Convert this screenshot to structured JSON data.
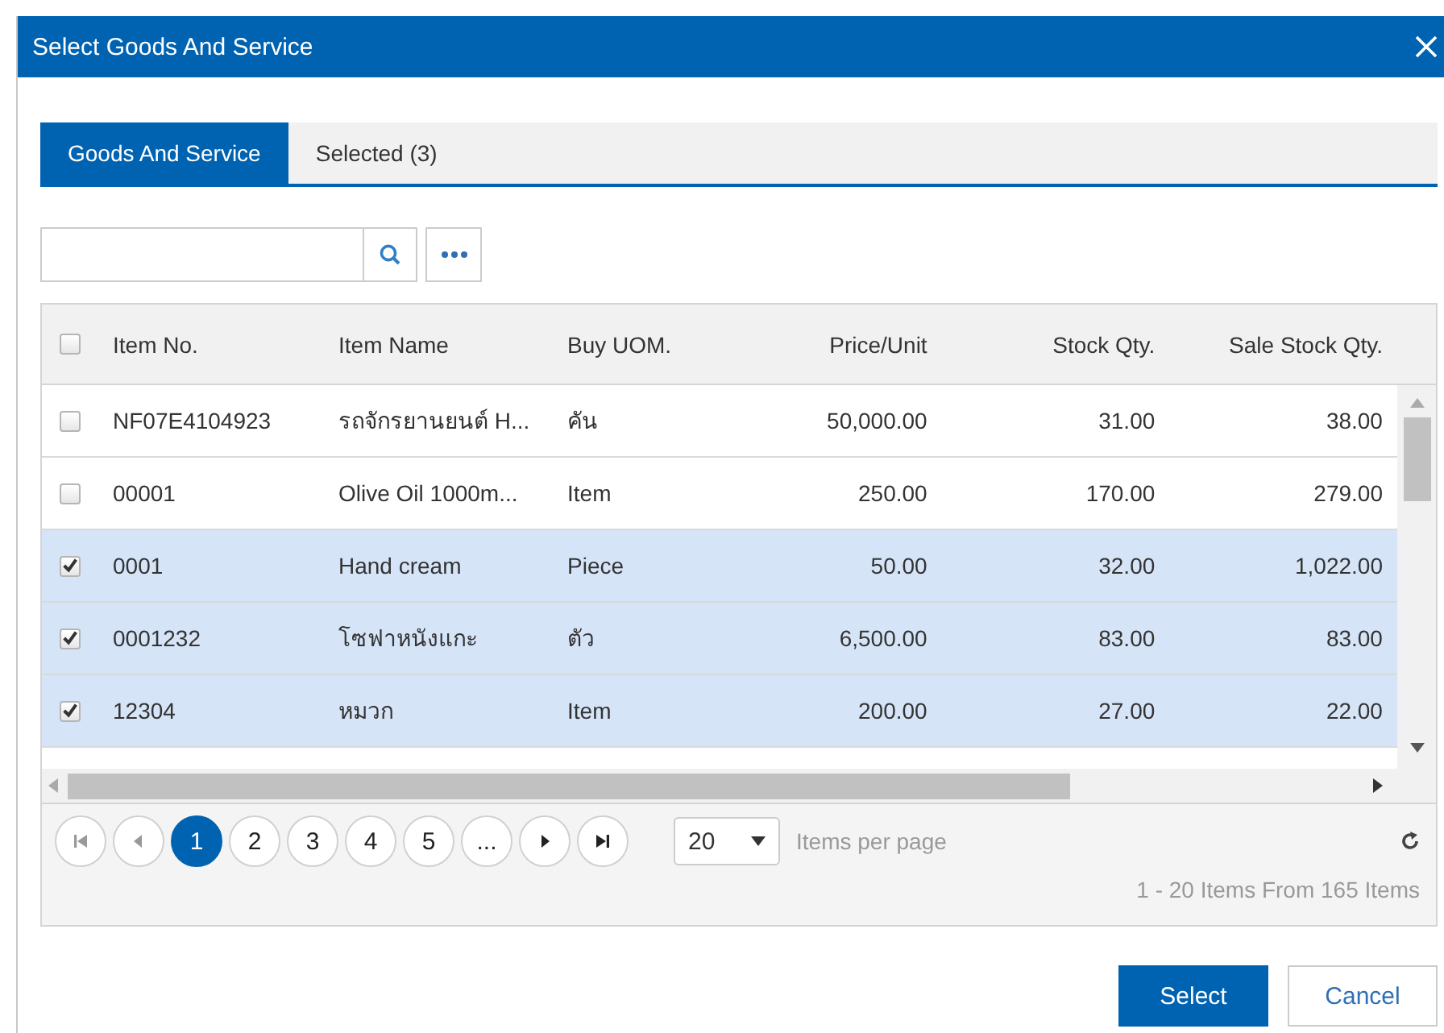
{
  "dialog": {
    "title": "Select Goods And Service"
  },
  "tabs": [
    {
      "label": "Goods And Service",
      "selected": true
    },
    {
      "label": "Selected (3)",
      "selected": false
    }
  ],
  "table": {
    "all_checked": false,
    "columns": [
      {
        "label": "Item No.",
        "kind": "text"
      },
      {
        "label": "Item Name",
        "kind": "text"
      },
      {
        "label": "Buy UOM.",
        "kind": "text"
      },
      {
        "label": "Price/Unit",
        "kind": "number"
      },
      {
        "label": "Stock Qty.",
        "kind": "number"
      },
      {
        "label": "Sale Stock Qty.",
        "kind": "number"
      }
    ],
    "rows": [
      {
        "checked": false,
        "cells": [
          "NF07E4104923",
          "รถจักรยานยนต์ H...",
          "คัน",
          "50,000.00",
          "31.00",
          "38.00"
        ]
      },
      {
        "checked": false,
        "cells": [
          "00001",
          "Olive Oil 1000m...",
          "Item",
          "250.00",
          "170.00",
          "279.00"
        ]
      },
      {
        "checked": true,
        "cells": [
          "0001",
          "Hand cream",
          "Piece",
          "50.00",
          "32.00",
          "1,022.00"
        ]
      },
      {
        "checked": true,
        "cells": [
          "0001232",
          "โซฟาหนังแกะ",
          "ตัว",
          "6,500.00",
          "83.00",
          "83.00"
        ]
      },
      {
        "checked": true,
        "cells": [
          "12304",
          "หมวก",
          "Item",
          "200.00",
          "27.00",
          "22.00"
        ]
      }
    ]
  },
  "pager": {
    "pages": [
      {
        "label": "1",
        "selected": true
      },
      {
        "label": "2",
        "selected": false
      },
      {
        "label": "3",
        "selected": false
      },
      {
        "label": "4",
        "selected": false
      },
      {
        "label": "5",
        "selected": false
      },
      {
        "label": "...",
        "selected": false
      }
    ],
    "page_size": "20",
    "page_size_label": "Items per page",
    "summary": "1 - 20 Items From 165 Items"
  },
  "buttons": [
    {
      "label": "Select",
      "kind": "primary"
    },
    {
      "label": "Cancel",
      "kind": "secondary"
    }
  ]
}
